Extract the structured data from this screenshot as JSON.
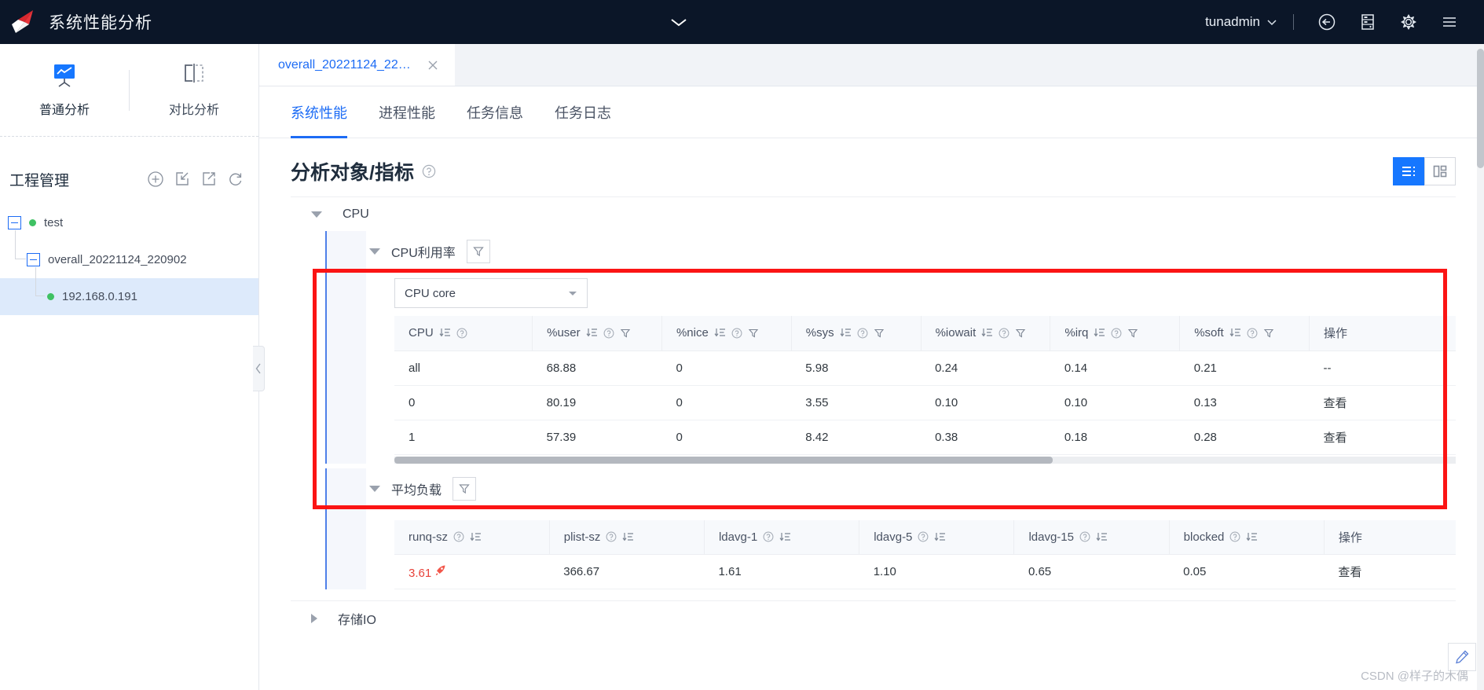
{
  "header": {
    "title": "系统性能分析",
    "logo": "kunpeng-logo-icon",
    "center_icon": "chevron-down-icon",
    "user": "tunadmin",
    "user_caret": "chevron-down-icon",
    "icons": [
      "logout-icon",
      "server-icon",
      "gear-icon",
      "menu-icon"
    ]
  },
  "sidebar": {
    "modes": [
      {
        "label": "普通分析",
        "icon": "chart-board-icon",
        "active": true
      },
      {
        "label": "对比分析",
        "icon": "compare-panels-icon",
        "active": false
      }
    ],
    "project": {
      "title": "工程管理",
      "actions": [
        "add-icon",
        "import-icon",
        "export-icon",
        "refresh-icon"
      ]
    },
    "tree": [
      {
        "label": "test",
        "level": 1,
        "expanded": true,
        "status": "online",
        "selected": false
      },
      {
        "label": "overall_20221124_220902",
        "level": 2,
        "expanded": true,
        "status": null,
        "selected": false
      },
      {
        "label": "192.168.0.191",
        "level": 3,
        "expanded": null,
        "status": "online",
        "selected": true
      }
    ],
    "collapse_handle": "chevron-left-icon"
  },
  "main": {
    "doc_tab": {
      "label": "overall_20221124_22…",
      "close": "close-icon"
    },
    "subtabs": [
      {
        "label": "系统性能",
        "active": true
      },
      {
        "label": "进程性能",
        "active": false
      },
      {
        "label": "任务信息",
        "active": false
      },
      {
        "label": "任务日志",
        "active": false
      }
    ],
    "section": {
      "title": "分析对象/指标",
      "help": "help-icon",
      "view_toggle": [
        {
          "icon": "list-view-icon",
          "active": true
        },
        {
          "icon": "grid-view-icon",
          "active": false
        }
      ]
    },
    "groups": [
      {
        "name": "CPU",
        "expanded": true
      },
      {
        "name": "存储IO",
        "expanded": false
      }
    ],
    "metrics": [
      {
        "name": "CPU利用率",
        "expanded": true,
        "filter_icon": "filter-icon",
        "select": {
          "value": "CPU core",
          "caret": "chevron-down-icon"
        },
        "columns": [
          {
            "label": "CPU",
            "sort": true,
            "help": true,
            "filter": false,
            "order": "sort-help"
          },
          {
            "label": "%user",
            "sort": true,
            "help": true,
            "filter": true,
            "order": "sort-help"
          },
          {
            "label": "%nice",
            "sort": true,
            "help": true,
            "filter": true,
            "order": "sort-help"
          },
          {
            "label": "%sys",
            "sort": true,
            "help": true,
            "filter": true,
            "order": "sort-help"
          },
          {
            "label": "%iowait",
            "sort": true,
            "help": true,
            "filter": true,
            "order": "sort-help"
          },
          {
            "label": "%irq",
            "sort": true,
            "help": true,
            "filter": true,
            "order": "sort-help"
          },
          {
            "label": "%soft",
            "sort": true,
            "help": true,
            "filter": true,
            "order": "sort-help"
          },
          {
            "label": "操作",
            "sort": false,
            "help": false,
            "filter": false,
            "order": "none"
          }
        ],
        "rows": [
          {
            "cells": [
              "all",
              "68.88",
              "0",
              "5.98",
              "0.24",
              "0.14",
              "0.21"
            ],
            "action": "--",
            "action_link": false
          },
          {
            "cells": [
              "0",
              "80.19",
              "0",
              "3.55",
              "0.10",
              "0.10",
              "0.13"
            ],
            "action": "查看",
            "action_link": true
          },
          {
            "cells": [
              "1",
              "57.39",
              "0",
              "8.42",
              "0.38",
              "0.18",
              "0.28"
            ],
            "action": "查看",
            "action_link": true
          }
        ],
        "scrollbar": {
          "thumb_pct": 62
        }
      },
      {
        "name": "平均负载",
        "expanded": true,
        "filter_icon": "filter-icon",
        "select": null,
        "columns": [
          {
            "label": "runq-sz",
            "sort": true,
            "help": true,
            "filter": false,
            "order": "help-sort"
          },
          {
            "label": "plist-sz",
            "sort": true,
            "help": true,
            "filter": false,
            "order": "help-sort"
          },
          {
            "label": "ldavg-1",
            "sort": true,
            "help": true,
            "filter": false,
            "order": "help-sort"
          },
          {
            "label": "ldavg-5",
            "sort": true,
            "help": true,
            "filter": false,
            "order": "help-sort"
          },
          {
            "label": "ldavg-15",
            "sort": true,
            "help": true,
            "filter": false,
            "order": "help-sort"
          },
          {
            "label": "blocked",
            "sort": true,
            "help": true,
            "filter": false,
            "order": "help-sort"
          },
          {
            "label": "操作",
            "sort": false,
            "help": false,
            "filter": false,
            "order": "none"
          }
        ],
        "rows": [
          {
            "cells": [
              "3.61",
              "366.67",
              "1.61",
              "1.10",
              "0.65",
              "0.05"
            ],
            "alert_first": true,
            "rocket": "rocket-icon",
            "action": "查看",
            "action_link": true
          }
        ],
        "scrollbar": null
      }
    ],
    "edit_fab": "edit-icon",
    "watermark": "CSDN @样子的木偶"
  },
  "colors": {
    "header_bg": "#0b1628",
    "accent": "#1d6cf5",
    "highlight_red": "#fb1414",
    "alert_text": "#e8423a",
    "status_green": "#3fc163",
    "toggle_active": "#1677ff"
  }
}
